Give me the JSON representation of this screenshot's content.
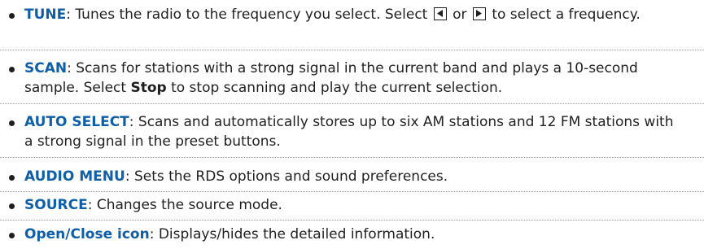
{
  "items": [
    {
      "term": "TUNE",
      "text_before": ": Tunes the radio to the frequency you select. Select ",
      "text_between": " or ",
      "text_after": " to select a frequency.",
      "left_icon": "left-arrow-button-icon",
      "right_icon": "right-arrow-button-icon"
    },
    {
      "term": "SCAN",
      "text_before": ": Scans for stations with a strong signal in the current band and plays a 10-second sample. Select ",
      "inline_bold": "Stop",
      "text_after": " to stop scanning and play the current selection."
    },
    {
      "term": "AUTO SELECT",
      "text": ": Scans and automatically stores up to six AM stations and 12 FM stations with a strong signal in the preset buttons."
    },
    {
      "term": "AUDIO MENU",
      "text": ": Sets the RDS options and sound preferences."
    },
    {
      "term": "SOURCE",
      "text": ": Changes the source mode."
    },
    {
      "term": "Open/Close icon",
      "text": ": Displays/hides the detailed information."
    }
  ],
  "colors": {
    "term": "#0f5fa8",
    "text": "#1f1f1f",
    "rule": "#9a9a9a"
  }
}
